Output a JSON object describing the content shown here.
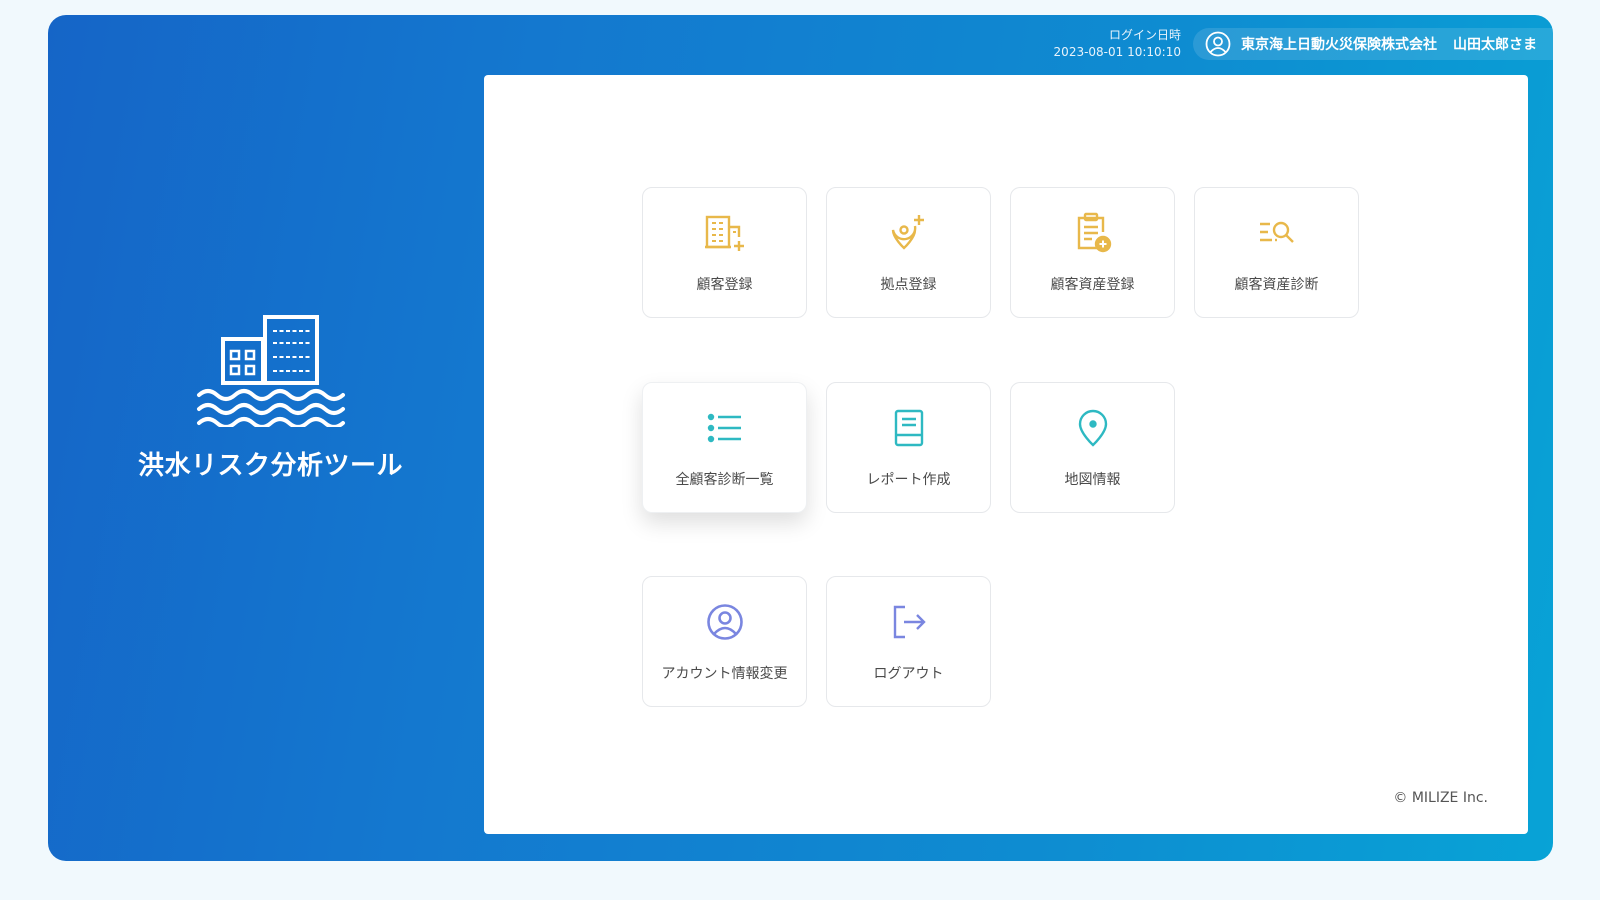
{
  "app": {
    "title": "洪水リスク分析ツール",
    "copyright": "© MILIZE Inc."
  },
  "header": {
    "login_label": "ログイン日時",
    "login_time": "2023-08-01 10:10:10",
    "company": "東京海上日動火災保険株式会社",
    "user": "山田太郎さま"
  },
  "menu": {
    "tiles": [
      {
        "label": "顧客登録",
        "icon": "building-add-icon",
        "color": "#e8b84a"
      },
      {
        "label": "拠点登録",
        "icon": "location-add-icon",
        "color": "#e8b84a"
      },
      {
        "label": "顧客資産登録",
        "icon": "clipboard-add-icon",
        "color": "#e8b84a"
      },
      {
        "label": "顧客資産診断",
        "icon": "list-search-icon",
        "color": "#e8b84a"
      },
      {
        "label": "全顧客診断一覧",
        "icon": "list-icon",
        "color": "#2eb9c2"
      },
      {
        "label": "レポート作成",
        "icon": "report-icon",
        "color": "#2eb9c2"
      },
      {
        "label": "地図情報",
        "icon": "map-pin-icon",
        "color": "#2eb9c2"
      },
      {
        "label": "アカウント情報変更",
        "icon": "account-icon",
        "color": "#7a86e0"
      },
      {
        "label": "ログアウト",
        "icon": "logout-icon",
        "color": "#7a86e0"
      }
    ]
  },
  "colors": {
    "brand_gradient_start": "#1565c7",
    "brand_gradient_end": "#08a3d6",
    "accent_yellow": "#e8b84a",
    "accent_teal": "#2eb9c2",
    "accent_purple": "#7a86e0"
  }
}
